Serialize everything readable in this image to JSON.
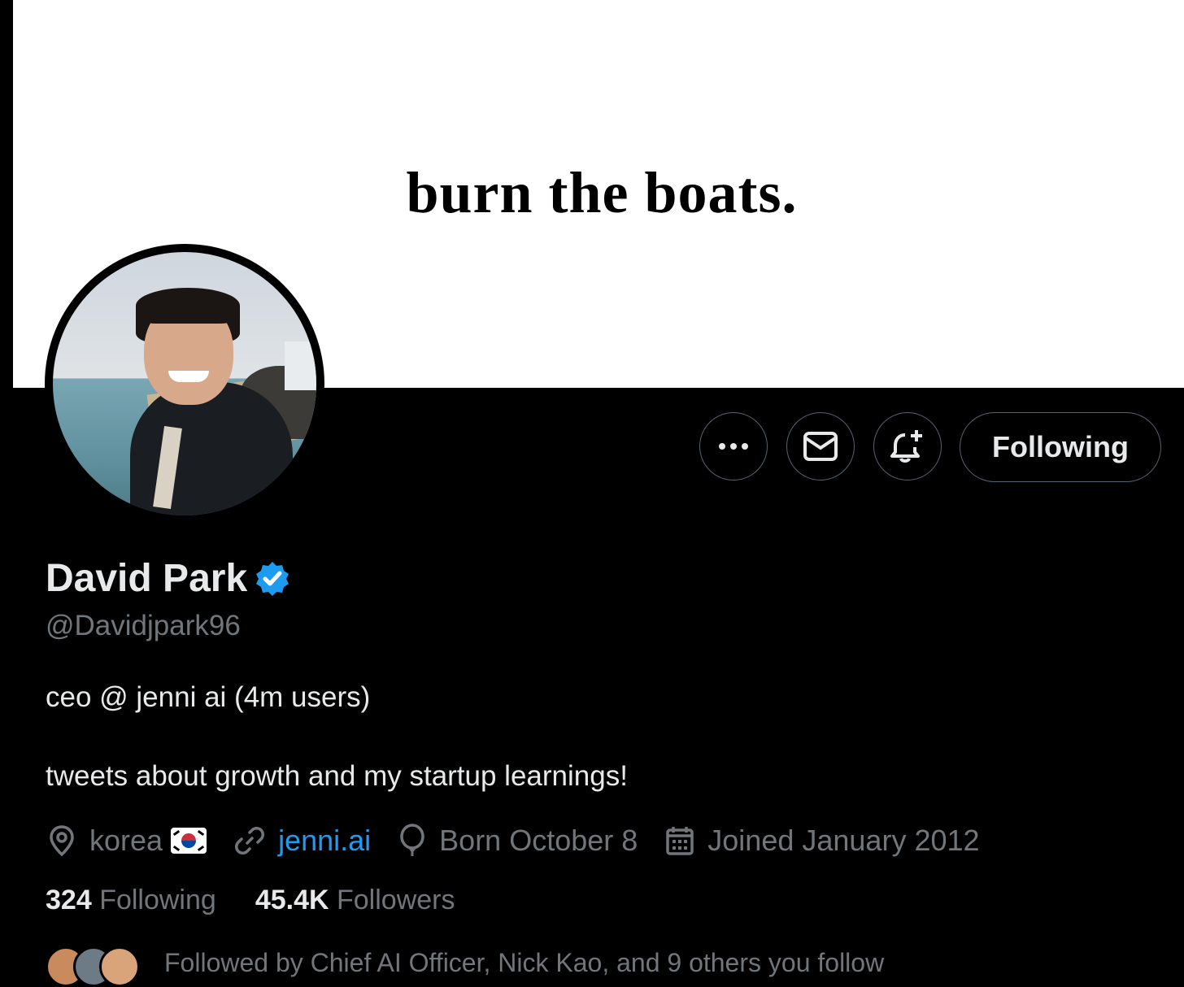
{
  "banner": {
    "text": "burn the boats."
  },
  "actions": {
    "follow_label": "Following"
  },
  "profile": {
    "name": "David Park",
    "handle": "@Davidjpark96",
    "bio_line1": "ceo @ jenni ai (4m users)",
    "bio_line2": "tweets about growth and my startup learnings!"
  },
  "meta": {
    "location": "korea",
    "website": "jenni.ai",
    "birthday": "Born October 8",
    "joined": "Joined January 2012"
  },
  "counts": {
    "following_num": "324",
    "following_label": "Following",
    "followers_num": "45.4K",
    "followers_label": "Followers"
  },
  "followed_by": "Followed by Chief AI Officer, Nick Kao, and 9 others you follow",
  "colors": {
    "background": "#000000",
    "primary_text": "#e7e9ea",
    "secondary_text": "#71767b",
    "link": "#1d9bf0",
    "border": "#536471",
    "verified": "#1d9bf0"
  },
  "icons": [
    "more-icon",
    "mail-icon",
    "bell-plus-icon",
    "verified-badge-icon",
    "location-icon",
    "link-icon",
    "balloon-icon",
    "calendar-icon",
    "korea-flag-icon"
  ]
}
